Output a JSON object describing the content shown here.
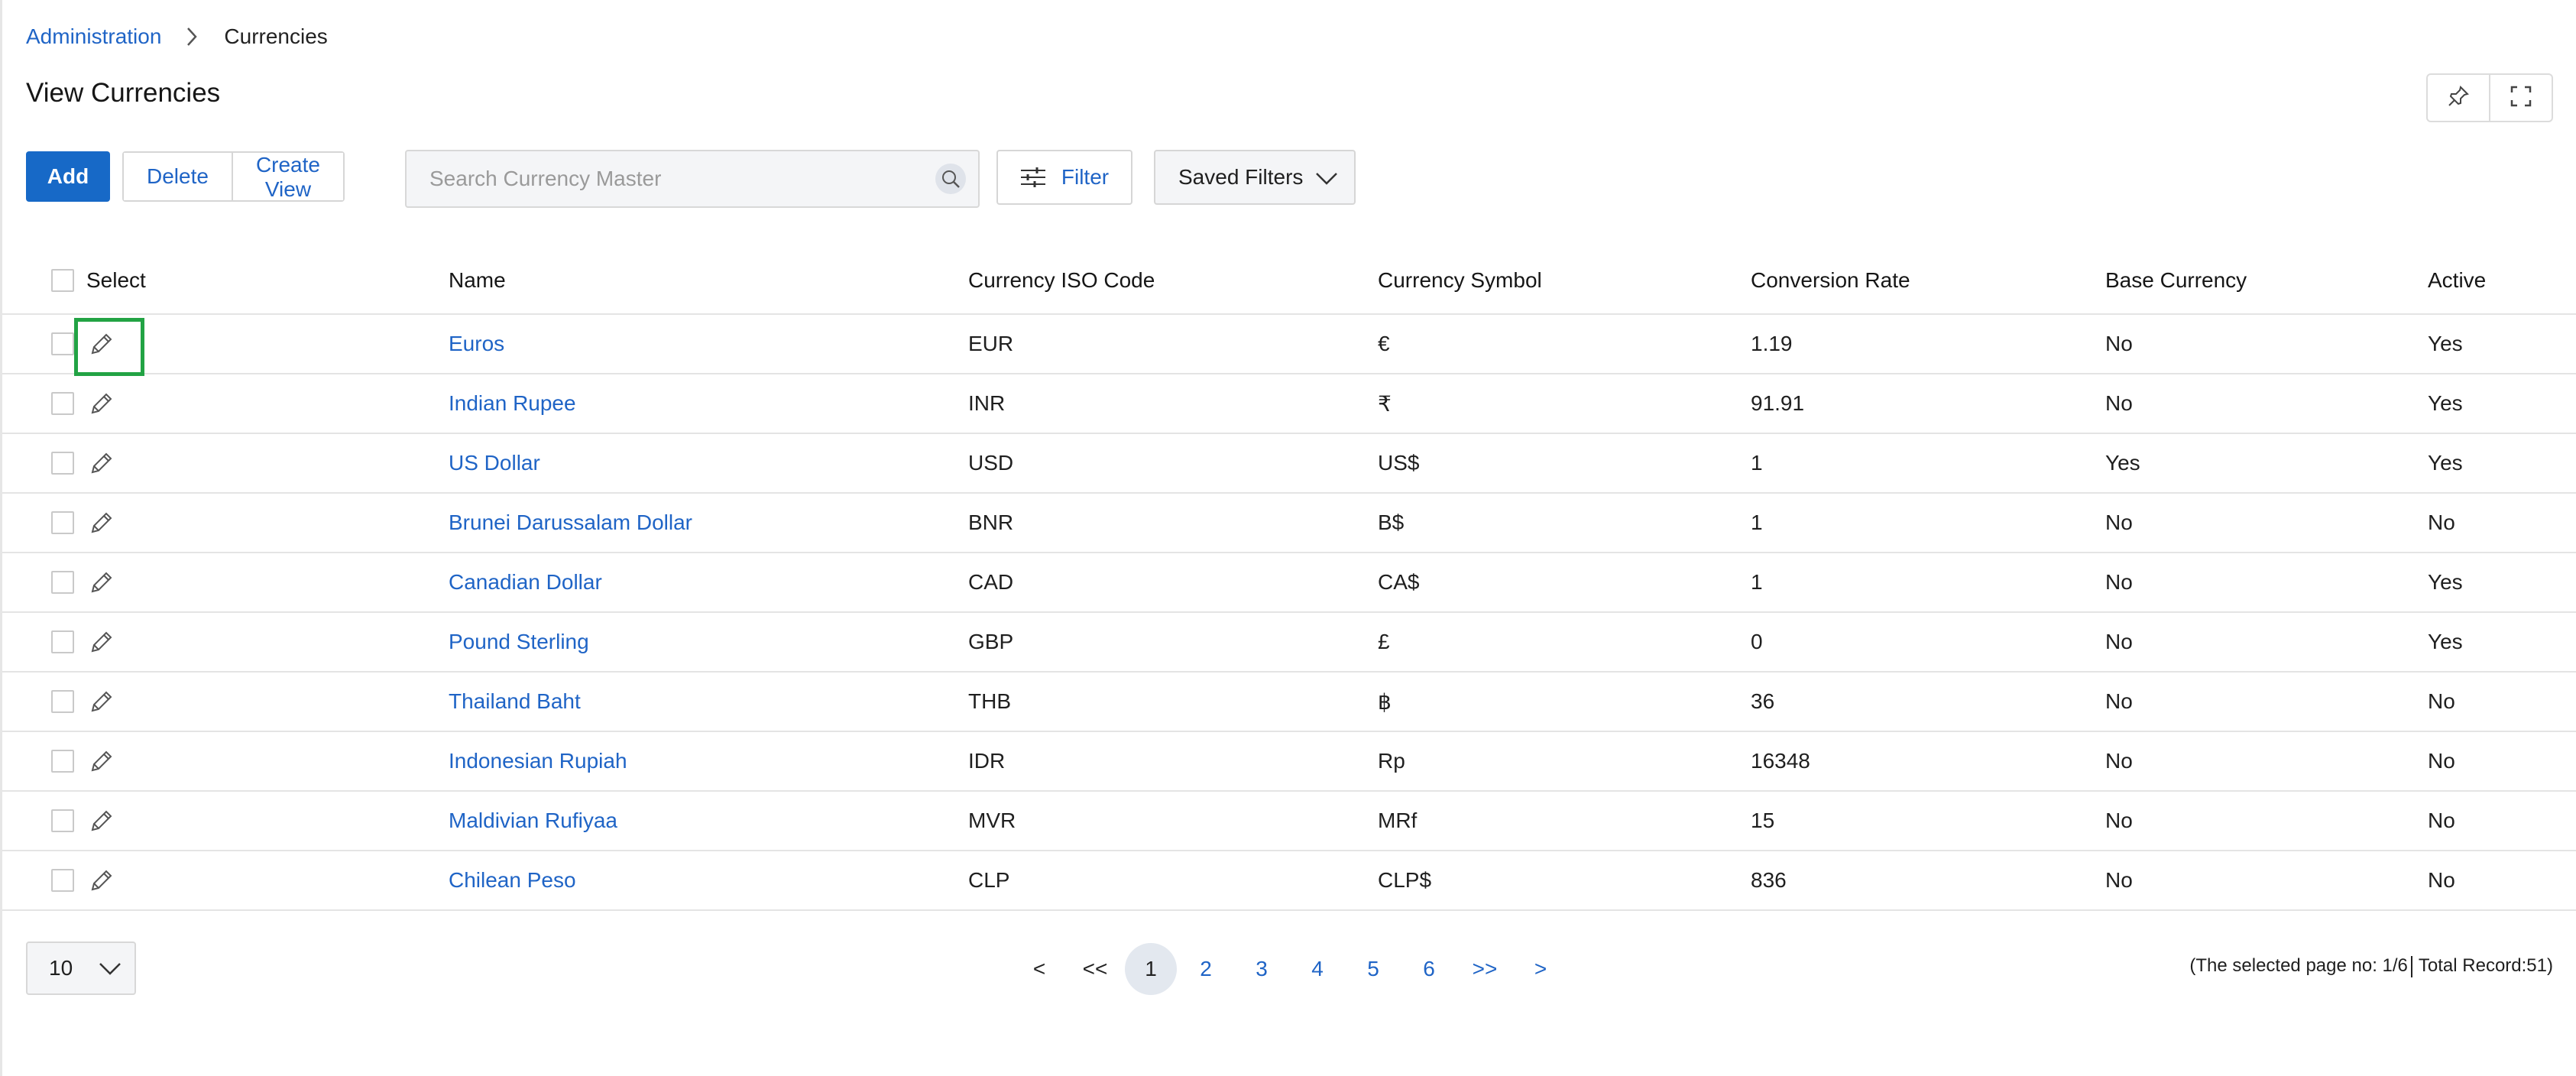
{
  "breadcrumb": {
    "parent": "Administration",
    "current": "Currencies"
  },
  "page_title": "View Currencies",
  "toolbar": {
    "add_label": "Add",
    "delete_label": "Delete",
    "create_view_label": "Create View",
    "search_placeholder": "Search Currency Master",
    "filter_label": "Filter",
    "saved_filters_label": "Saved Filters"
  },
  "table": {
    "columns": [
      "Select",
      "Name",
      "Currency ISO Code",
      "Currency Symbol",
      "Conversion Rate",
      "Base Currency",
      "Active"
    ],
    "rows": [
      {
        "name": "Euros",
        "iso": "EUR",
        "symbol": "€",
        "rate": "1.19",
        "base": "No",
        "active": "Yes"
      },
      {
        "name": "Indian Rupee",
        "iso": "INR",
        "symbol": "₹",
        "rate": "91.91",
        "base": "No",
        "active": "Yes"
      },
      {
        "name": "US Dollar",
        "iso": "USD",
        "symbol": "US$",
        "rate": "1",
        "base": "Yes",
        "active": "Yes"
      },
      {
        "name": "Brunei Darussalam Dollar",
        "iso": "BNR",
        "symbol": "B$",
        "rate": "1",
        "base": "No",
        "active": "No"
      },
      {
        "name": "Canadian Dollar",
        "iso": "CAD",
        "symbol": "CA$",
        "rate": "1",
        "base": "No",
        "active": "Yes"
      },
      {
        "name": "Pound Sterling",
        "iso": "GBP",
        "symbol": "£",
        "rate": "0",
        "base": "No",
        "active": "Yes"
      },
      {
        "name": "Thailand Baht",
        "iso": "THB",
        "symbol": "฿",
        "rate": "36",
        "base": "No",
        "active": "No"
      },
      {
        "name": "Indonesian Rupiah",
        "iso": "IDR",
        "symbol": "Rp",
        "rate": "16348",
        "base": "No",
        "active": "No"
      },
      {
        "name": "Maldivian Rufiyaa",
        "iso": "MVR",
        "symbol": "MRf",
        "rate": "15",
        "base": "No",
        "active": "No"
      },
      {
        "name": "Chilean Peso",
        "iso": "CLP",
        "symbol": "CLP$",
        "rate": "836",
        "base": "No",
        "active": "No"
      }
    ]
  },
  "pagination": {
    "page_size": "10",
    "prev": "<",
    "first": "<<",
    "pages": [
      "1",
      "2",
      "3",
      "4",
      "5",
      "6"
    ],
    "current_page": "1",
    "last": ">>",
    "next": ">",
    "status_page": "(The selected page no: 1/6",
    "status_total": "Total Record:51)"
  },
  "colors": {
    "accent": "#1769c7",
    "link": "#1f64c6",
    "focus_outline": "#22a344"
  },
  "icons": [
    "chevron-right-icon",
    "pin-icon",
    "fullscreen-icon",
    "search-icon",
    "filter-sliders-icon",
    "chevron-down-icon",
    "pencil-edit-icon"
  ]
}
